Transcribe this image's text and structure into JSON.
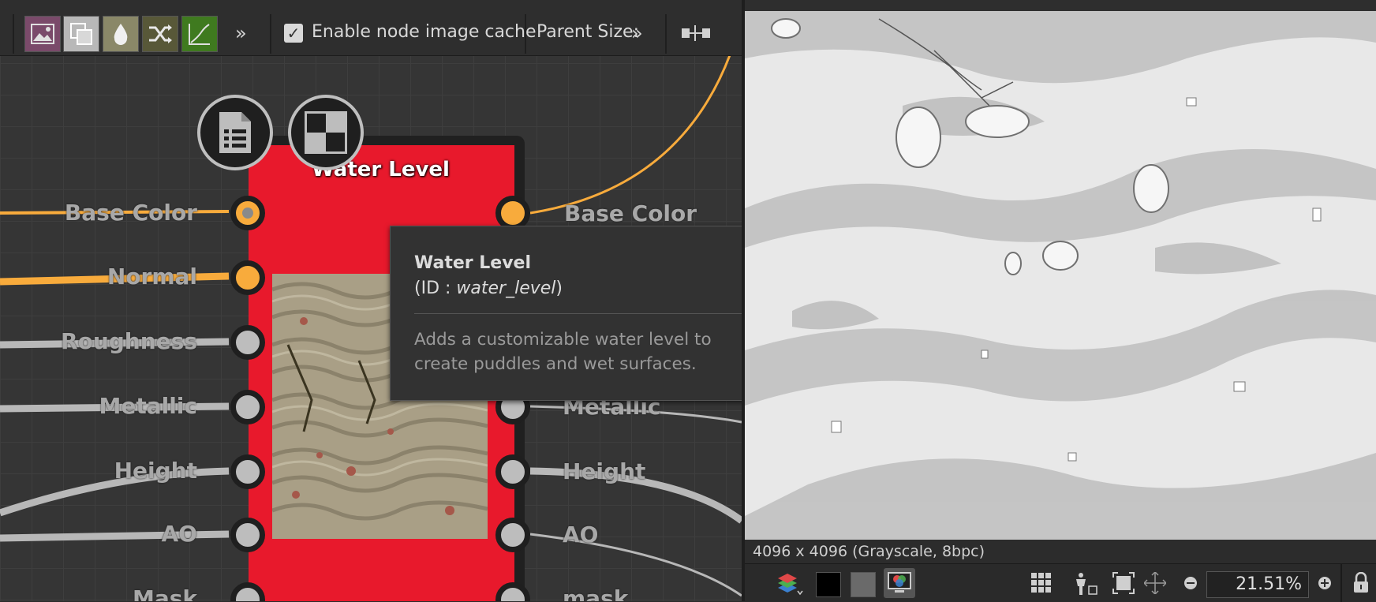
{
  "toolbar": {
    "enable_cache_label": "Enable node image cache",
    "enable_cache_checked": true,
    "parent_size_label": "Parent Size:",
    "overflow_glyph": "»",
    "buttons": [
      {
        "name": "image-icon",
        "color": "#7a4a6a"
      },
      {
        "name": "layers-icon",
        "color": "#b8b8b8"
      },
      {
        "name": "droplet-icon",
        "color": "#8a8868"
      },
      {
        "name": "shuffle-icon",
        "color": "#585838"
      },
      {
        "name": "curve-icon",
        "color": "#3f7a1f"
      }
    ]
  },
  "node": {
    "title": "Water Level",
    "color": "#e8192c",
    "input_slots": [
      "Base Color",
      "Normal",
      "Roughness",
      "Metallic",
      "Height",
      "AO",
      "Mask"
    ],
    "output_slots": [
      "Base Color",
      "",
      "",
      "Metallic",
      "Height",
      "AO",
      "mask"
    ],
    "active_inputs": [
      "Base Color",
      "Normal"
    ],
    "active_outputs": [
      "Base Color"
    ]
  },
  "tooltip": {
    "title": "Water Level",
    "id_prefix": "(ID : ",
    "id_value": "water_level",
    "id_suffix": ")",
    "description": "Adds a customizable water level to create puddles and wet surfaces."
  },
  "viewer": {
    "status": "4096 x 4096 (Grayscale, 8bpc)",
    "zoom": "21.51%"
  },
  "colors": {
    "accent_orange": "#f8ab3c",
    "node_red": "#e8192c",
    "toolbar_green": "#3f7a1f"
  }
}
